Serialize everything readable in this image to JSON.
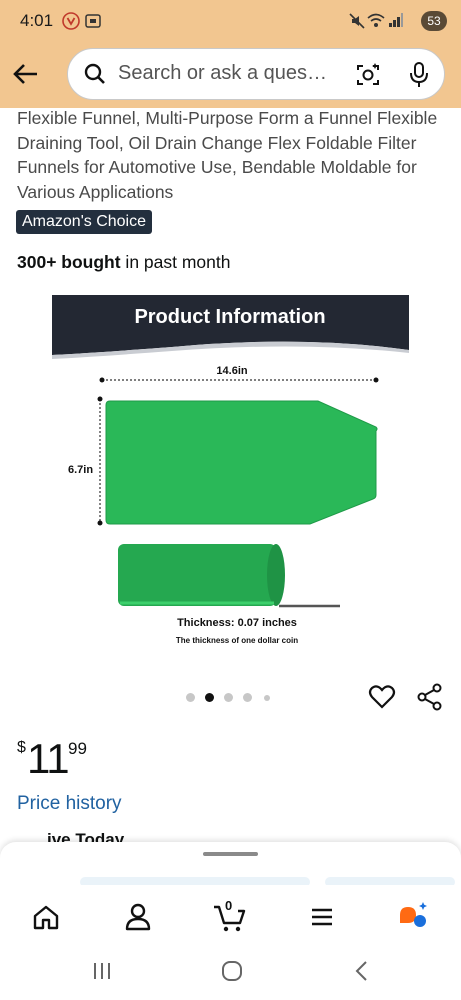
{
  "status_bar": {
    "time": "4:01",
    "battery": "53",
    "icons": [
      "shield-app-icon",
      "screenshot-icon",
      "mute-icon",
      "wifi-icon",
      "signal-icon",
      "battery-icon"
    ]
  },
  "search": {
    "placeholder": "Search or ask a ques…",
    "icons": [
      "back-arrow-icon",
      "search-icon",
      "camera-icon",
      "mic-icon"
    ]
  },
  "product": {
    "title": "Flexible Funnel, Multi-Purpose Form a Funnel Flexible Draining Tool, Oil Drain Change Flex Foldable Filter Funnels for Automotive Use, Bendable Moldable for Various Applications",
    "badge": "Amazon's Choice",
    "bought_bold": "300+ bought",
    "bought_rest": " in past month",
    "price_symbol": "$",
    "price_whole": "11",
    "price_fraction": "99",
    "price_history": "Price history"
  },
  "image": {
    "header": "Product Information",
    "width_label": "14.6in",
    "height_label": "6.7in",
    "thickness": "Thickness: 0.07 inches",
    "thickness_note": "The thickness of one dollar coin",
    "carousel_total": 5,
    "carousel_active": 2
  },
  "peek": {
    "text": "…ive Today"
  },
  "bottom_nav": {
    "items": [
      "home-icon",
      "account-icon",
      "cart-icon",
      "menu-icon",
      "rufus-ai-icon"
    ],
    "cart_count": "0"
  },
  "system_nav": [
    "recents-icon",
    "home-circle-icon",
    "back-icon"
  ],
  "colors": {
    "header_bg": "#f2c690",
    "badge_bg": "#232f3e",
    "link": "#2162a1",
    "product_green": "#2ab858",
    "image_banner": "#232833"
  }
}
